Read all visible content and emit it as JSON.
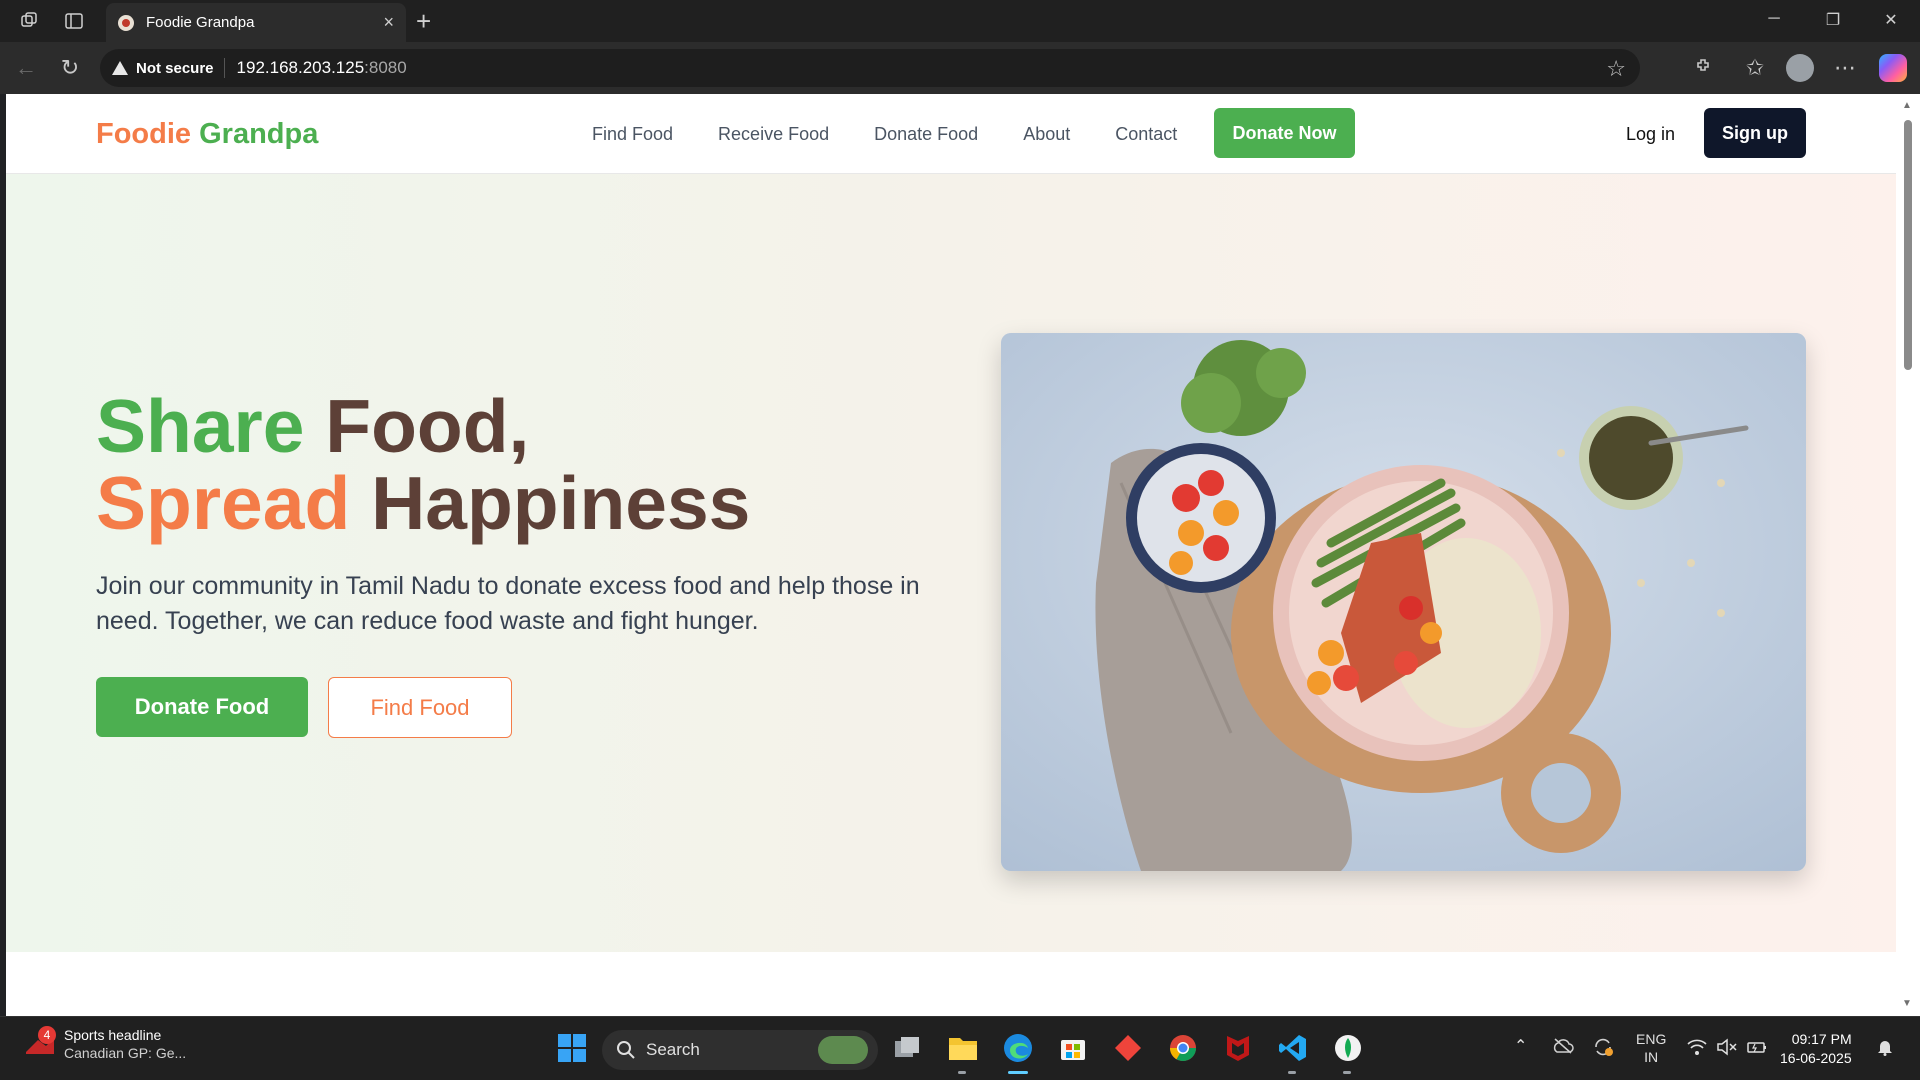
{
  "browser": {
    "tab_title": "Foodie Grandpa",
    "tab_close_icon": "×",
    "new_tab_icon": "+",
    "security_label": "Not secure",
    "url_host": "192.168.203.125",
    "url_port": ":8080"
  },
  "site": {
    "logo_part1": "Foodie",
    "logo_part2": "Grandpa",
    "nav": [
      {
        "label": "Find Food"
      },
      {
        "label": "Receive Food"
      },
      {
        "label": "Donate Food"
      },
      {
        "label": "About"
      },
      {
        "label": "Contact"
      }
    ],
    "donate_now_label": "Donate Now",
    "login_label": "Log in",
    "signup_label": "Sign up"
  },
  "hero": {
    "title_word1": "Share",
    "title_word2": "Food,",
    "title_word3": "Spread",
    "title_word4": "Happiness",
    "subtitle": "Join our community in Tamil Nadu to donate excess food and help those in need. Together, we can reduce food waste and fight hunger.",
    "btn_donate": "Donate Food",
    "btn_find": "Find Food"
  },
  "taskbar": {
    "news_badge": "4",
    "news_headline": "Sports headline",
    "news_sub": "Canadian GP: Ge...",
    "search_label": "Search",
    "lang_line1": "ENG",
    "lang_line2": "IN",
    "time": "09:17 PM",
    "date": "16-06-2025"
  },
  "colors": {
    "brand_green": "#4caf50",
    "brand_orange": "#f47c48",
    "brand_brown": "#5d4037",
    "dark_navy": "#0f172a"
  }
}
